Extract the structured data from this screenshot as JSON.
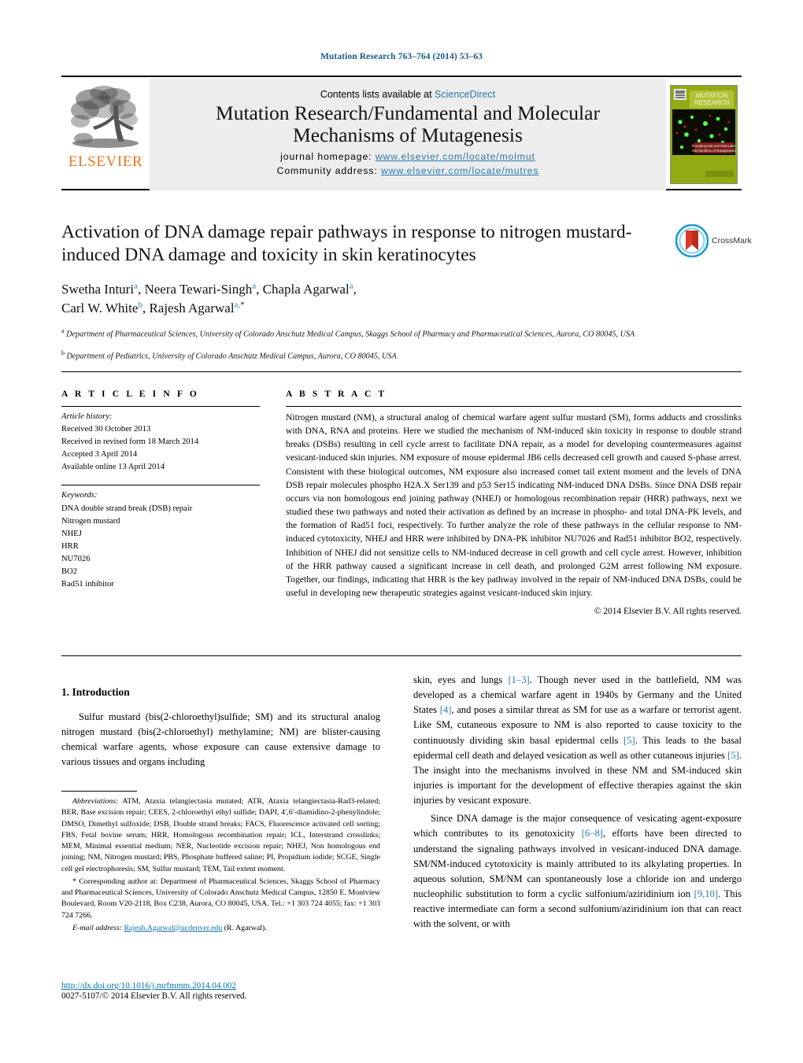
{
  "running_head": "Mutation Research 763–764 (2014) 53–63",
  "masthead": {
    "contents_prefix": "Contents lists available at ",
    "contents_link": "ScienceDirect",
    "journal_title_line1": "Mutation Research/Fundamental and Molecular",
    "journal_title_line2": "Mechanisms of Mutagenesis",
    "homepage_label": "journal homepage:",
    "homepage_url": "www.elsevier.com/locate/molmut",
    "community_label": "Community address:",
    "community_url": "www.elsevier.com/locate/mutres",
    "publisher_logo_text": "ELSEVIER",
    "cover_title_line1": "MUTATION",
    "cover_title_line2": "RESEARCH",
    "cover_subtitle_line1": "Fundamental and Molecular",
    "cover_subtitle_line2": "Mechanisms of Mutagenesis"
  },
  "title": {
    "line1": "Activation of DNA damage repair pathways in response to nitrogen",
    "line2": "mustard-induced DNA damage and toxicity in skin keratinocytes"
  },
  "crossmark": {
    "label": "CrossMark"
  },
  "authors": {
    "line1": "Swetha Inturi",
    "line1_sup1": "a",
    "line1_b": ", Neera Tewari-Singh",
    "line1_sup2": "a",
    "line1_c": ", Chapla Agarwal",
    "line1_sup3": "a",
    "line1_tail": ",",
    "line2": "Carl W. White",
    "line2_sup1": "b",
    "line2_b": ", Rajesh Agarwal",
    "line2_sup2": "a,",
    "line2_star": "*"
  },
  "affiliations": [
    {
      "marker": "a",
      "text": "Department of Pharmaceutical Sciences, University of Colorado Anschutz Medical Campus, Skaggs School of Pharmacy and Pharmaceutical Sciences, Aurora, CO 80045, USA"
    },
    {
      "marker": "b",
      "text": "Department of Pediatrics, University of Colorado Anschutz Medical Campus, Aurora, CO 80045, USA"
    }
  ],
  "article_info": {
    "heading": "A R T I C L E   I N F O",
    "history_label": "Article history:",
    "history": [
      "Received 30 October 2013",
      "Received in revised form 18 March 2014",
      "Accepted 3 April 2014",
      "Available online 13 April 2014"
    ],
    "keywords_label": "Keywords:",
    "keywords": [
      "DNA double strand break (DSB) repair",
      "Nitrogen mustard",
      "NHEJ",
      "HRR",
      "NU7026",
      "BO2",
      "Rad51 inhibitor"
    ]
  },
  "abstract": {
    "heading": "A B S T R A C T",
    "text": "Nitrogen mustard (NM), a structural analog of chemical warfare agent sulfur mustard (SM), forms adducts and crosslinks with DNA, RNA and proteins. Here we studied the mechanism of NM-induced skin toxicity in response to double strand breaks (DSBs) resulting in cell cycle arrest to facilitate DNA repair, as a model for developing countermeasures against vesicant-induced skin injuries. NM exposure of mouse epidermal JB6 cells decreased cell growth and caused S-phase arrest. Consistent with these biological outcomes, NM exposure also increased comet tail extent moment and the levels of DNA DSB repair molecules phospho H2A.X Ser139 and p53 Ser15 indicating NM-induced DNA DSBs. Since DNA DSB repair occurs via non homologous end joining pathway (NHEJ) or homologous recombination repair (HRR) pathways, next we studied these two pathways and noted their activation as defined by an increase in phospho- and total DNA-PK levels, and the formation of Rad51 foci, respectively. To further analyze the role of these pathways in the cellular response to NM-induced cytotoxicity, NHEJ and HRR were inhibited by DNA-PK inhibitor NU7026 and Rad51 inhibitor BO2, respectively. Inhibition of NHEJ did not sensitize cells to NM-induced decrease in cell growth and cell cycle arrest. However, inhibition of the HRR pathway caused a significant increase in cell death, and prolonged G2M arrest following NM exposure. Together, our findings, indicating that HRR is the key pathway involved in the repair of NM-induced DNA DSBs, could be useful in developing new therapeutic strategies against vesicant-induced skin injury.",
    "copyright": "© 2014 Elsevier B.V. All rights reserved."
  },
  "introduction": {
    "heading": "1.  Introduction",
    "left_para1": "Sulfur mustard (bis(2-chloroethyl)sulfide; SM) and its structural analog nitrogen mustard (bis(2-chloroethyl) methylamine; NM) are blister-causing chemical warfare agents, whose exposure can cause extensive damage to various tissues and organs including",
    "right_para1_a": "skin, eyes and lungs ",
    "right_para1_ref1": "[1–3]",
    "right_para1_b": ". Though never used in the battlefield, NM was developed as a chemical warfare agent in 1940s by Germany and the United States ",
    "right_para1_ref2": "[4]",
    "right_para1_c": ", and poses a similar threat as SM for use as a warfare or terrorist agent. Like SM, cutaneous exposure to NM is also reported to cause toxicity to the continuously dividing skin basal epidermal cells ",
    "right_para1_ref3": "[5]",
    "right_para1_d": ". This leads to the basal epidermal cell death and delayed vesication as well as other cutaneous injuries ",
    "right_para1_ref4": "[5]",
    "right_para1_e": ". The insight into the mechanisms involved in these NM and SM-induced skin injuries is important for the development of effective therapies against the skin injuries by vesicant exposure.",
    "right_para2_a": "Since DNA damage is the major consequence of vesicating agent-exposure which contributes to its genotoxicity ",
    "right_para2_ref1": "[6–8]",
    "right_para2_b": ", efforts have been directed to understand the signaling pathways involved in vesicant-induced DNA damage. SM/NM-induced cytotoxicity is mainly attributed to its alkylating properties. In aqueous solution, SM/NM can spontaneously lose a chloride ion and undergo nucleophilic substitution to form a cyclic sulfonium/aziridinium ion ",
    "right_para2_ref2": "[9,10]",
    "right_para2_c": ". This reactive intermediate can form a second sulfonium/aziridinium ion that can react with the solvent, or with"
  },
  "footnotes": {
    "abbreviations_label": "Abbreviations:",
    "abbreviations_text": "  ATM, Ataxia telangiectasia mutated; ATR, Ataxia telangiectasia-Rad3-related; BER, Base excision repair; CEES, 2-chloroethyl ethyl sulfide; DAPI, 4′,6′-diamidino-2-phenylindole; DMSO, Dimethyl sulfoxide; DSB, Double strand breaks; FACS, Fluorescence activated cell sorting; FBS, Fetal bovine serum; HRR, Homologous recombination repair; ICL, Interstrand crosslinks; MEM, Minimal essential medium; NER, Nucleotide excision repair; NHEJ, Non homologous end joining; NM, Nitrogen mustard; PBS, Phosphate buffered saline; PI, Propidium iodide; SCGE, Single cell gel electrophoresis; SM, Sulfur mustard; TEM, Tail extent moment.",
    "corresponding_star": "*",
    "corresponding_text": " Corresponding author at: Department of Pharmaceutical Sciences, Skaggs School of Pharmacy and Pharmaceutical Sciences, University of Colorado Anschutz Medical Campus, 12850 E. Montview Boulevard, Room V20-2118, Box C238, Aurora, CO 80045, USA. Tel.: +1 303 724 4055; fax: +1 303 724 7266.",
    "email_label": "E-mail address:",
    "email": "Rajesh.Agarwal@ucdenver.edu",
    "email_suffix": " (R. Agarwal)."
  },
  "footer": {
    "doi_url": "http://dx.doi.org/10.1016/j.mrfmmm.2014.04.002",
    "issn_copyright": "0027-5107/© 2014 Elsevier B.V. All rights reserved."
  },
  "colors": {
    "link": "#2a7ab0",
    "doi_link": "#0a72a8",
    "elsevier_orange": "#E87722",
    "running_head": "#1a5a8a",
    "cover_green": "#8ca81c"
  }
}
